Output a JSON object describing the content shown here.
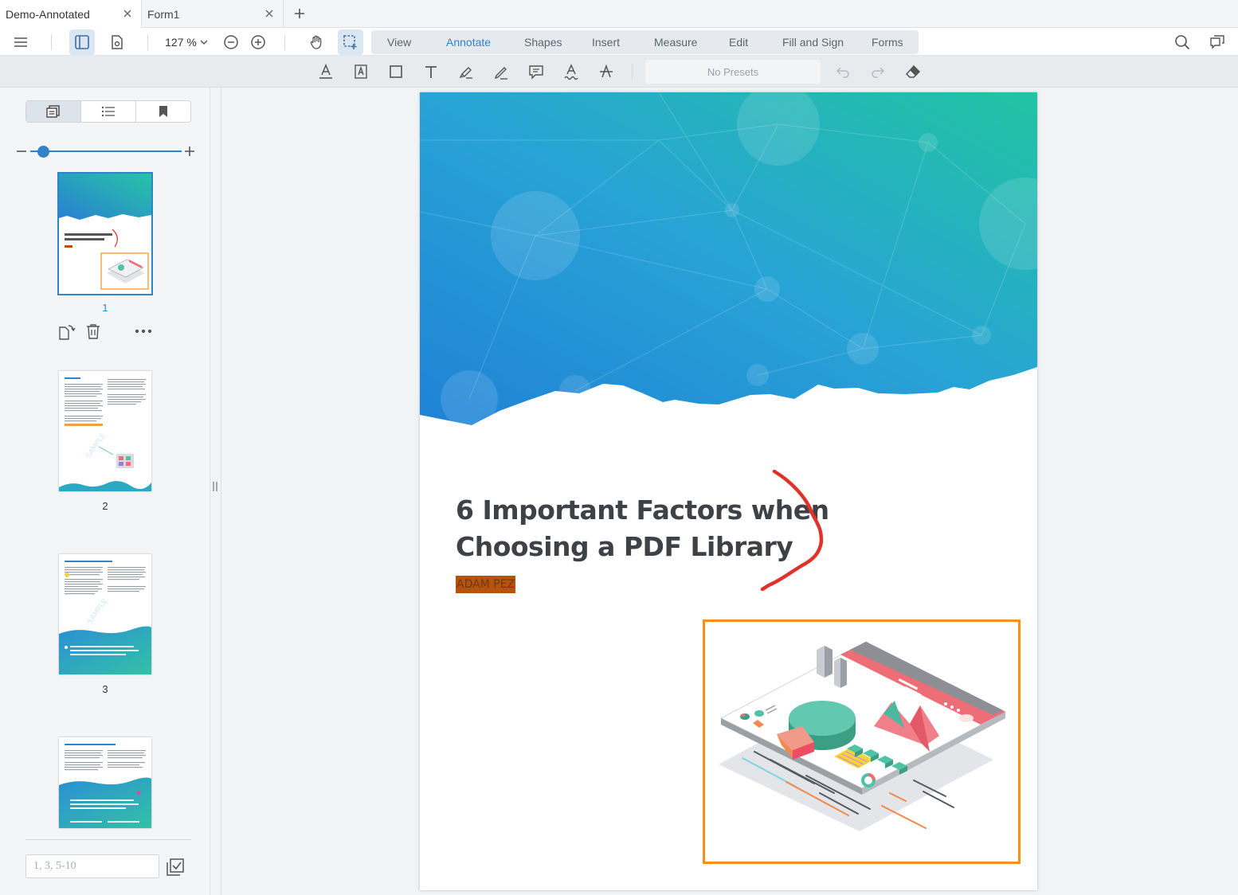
{
  "tabs": [
    {
      "label": "Demo-Annotated",
      "active": true
    },
    {
      "label": "Form1",
      "active": false
    }
  ],
  "header": {
    "zoom": "127 %",
    "ribbon_tabs": [
      "View",
      "Annotate",
      "Shapes",
      "Insert",
      "Measure",
      "Edit",
      "Fill and Sign",
      "Forms"
    ],
    "active_ribbon_tab": "Annotate"
  },
  "annot_toolbar": {
    "presets": "No Presets"
  },
  "thumbnails": {
    "pages": [
      "1",
      "2",
      "3"
    ],
    "current_page": "1"
  },
  "page_input": {
    "placeholder": "1, 3, 5-10"
  },
  "document": {
    "title_line1": "6 Important Factors when",
    "title_line2": "Choosing a PDF Library",
    "author": "ADAM PEZ"
  },
  "colors": {
    "accent": "#3183c8",
    "ink_annotation": "#e0322b",
    "rect_annotation": "#f29318",
    "highlight": "#b8530e"
  }
}
